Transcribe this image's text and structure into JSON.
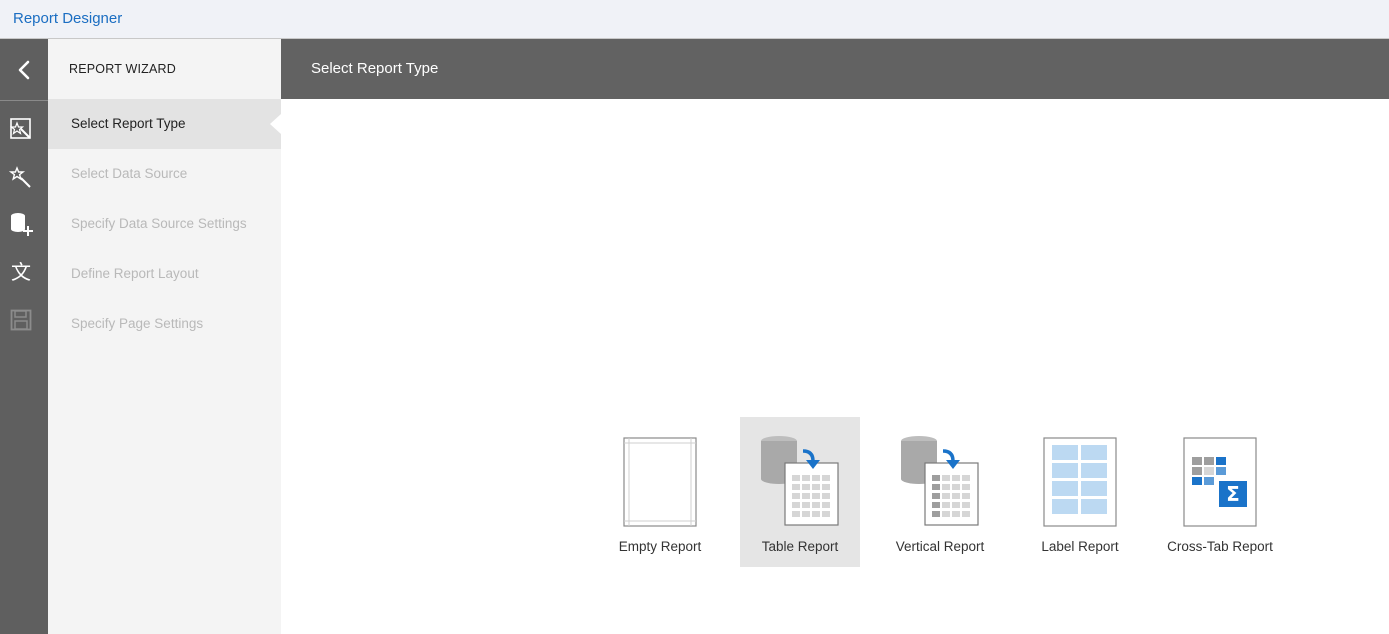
{
  "app": {
    "title": "Report Designer"
  },
  "wizard": {
    "header": "REPORT WIZARD",
    "steps": [
      {
        "label": "Select Report Type",
        "active": true
      },
      {
        "label": "Select Data Source",
        "active": false
      },
      {
        "label": "Specify Data Source Settings",
        "active": false
      },
      {
        "label": "Define Report Layout",
        "active": false
      },
      {
        "label": "Specify Page Settings",
        "active": false
      }
    ]
  },
  "main": {
    "title": "Select Report Type"
  },
  "report_types": [
    {
      "label": "Empty Report",
      "icon": "empty-report-icon",
      "selected": false
    },
    {
      "label": "Table Report",
      "icon": "table-report-icon",
      "selected": true
    },
    {
      "label": "Vertical Report",
      "icon": "vertical-report-icon",
      "selected": false
    },
    {
      "label": "Label Report",
      "icon": "label-report-icon",
      "selected": false
    },
    {
      "label": "Cross-Tab Report",
      "icon": "cross-tab-report-icon",
      "selected": false
    }
  ],
  "iconbar": [
    "back-icon",
    "report-wizard-icon",
    "magic-wand-icon",
    "add-data-source-icon",
    "localization-icon",
    "save-icon"
  ],
  "colors": {
    "accent": "#1b6ec2",
    "header_bg": "#626262",
    "sidebar_bg": "#5f5f5f",
    "blue_arrow": "#1a73c9"
  }
}
